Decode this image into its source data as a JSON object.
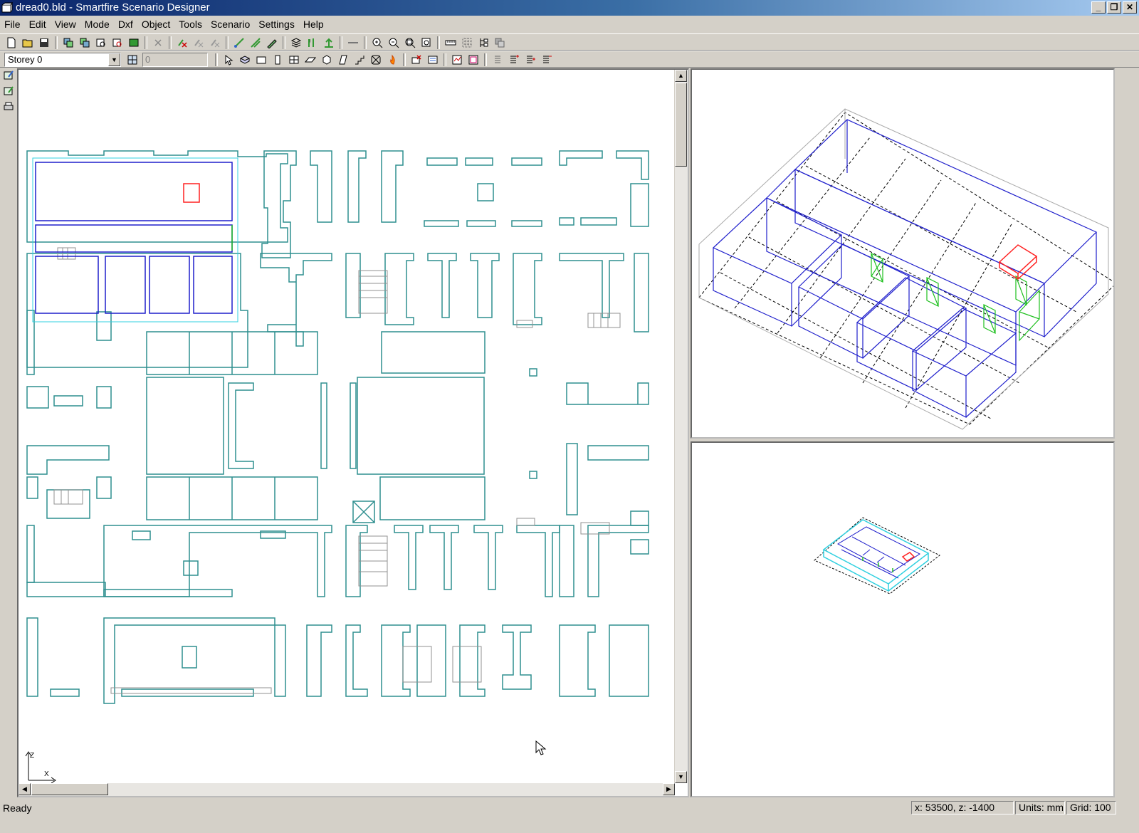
{
  "window": {
    "title": "dread0.bld - Smartfire Scenario Designer",
    "minimize": "_",
    "maximize": "❐",
    "close": "✕"
  },
  "menubar": {
    "items": [
      "File",
      "Edit",
      "View",
      "Mode",
      "Dxf",
      "Object",
      "Tools",
      "Scenario",
      "Settings",
      "Help"
    ]
  },
  "toolbar2": {
    "storey_select": "Storey 0",
    "grid_value": "0"
  },
  "status": {
    "text": "Ready",
    "coordinates": "x: 53500, z: -1400",
    "units": "Units: mm",
    "grid": "Grid: 100"
  },
  "axes": {
    "z": "Z",
    "x": "X"
  },
  "colors": {
    "walls": "#2f8f8f",
    "rooms": "#1f1fcc",
    "selected": "#ff2020",
    "vents": "#20c020",
    "light_walls": "#909090"
  }
}
